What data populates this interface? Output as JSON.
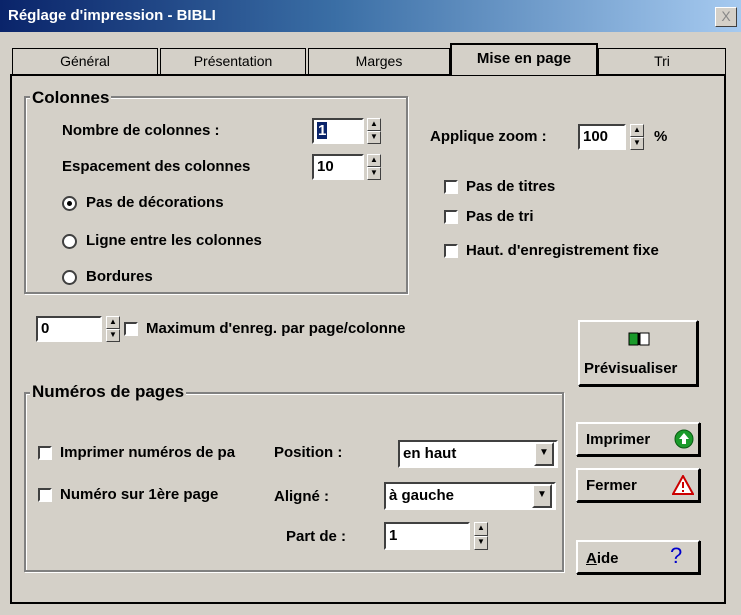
{
  "window": {
    "title": "Réglage d'impression - BIBLI",
    "close_glyph": "X"
  },
  "tabs": [
    "Général",
    "Présentation",
    "Marges",
    "Mise en page",
    "Tri"
  ],
  "colonnes": {
    "legend": "Colonnes",
    "nb_label": "Nombre de colonnes :",
    "nb_value": "1",
    "espacement_label": "Espacement des colonnes",
    "espacement_value": "10",
    "radios": [
      "Pas de décorations",
      "Ligne entre les colonnes",
      "Bordures"
    ],
    "selected_radio": 0
  },
  "zoom": {
    "label": "Applique zoom :",
    "value": "100",
    "unit": "%"
  },
  "options": [
    "Pas de titres",
    "Pas de tri",
    "Haut. d'enregistrement fixe"
  ],
  "max_enreg": {
    "value": "0",
    "label": "Maximum d'enreg. par page/colonne"
  },
  "numeros": {
    "legend": "Numéros de pages",
    "imprimer_label": "Imprimer numéros de pa",
    "premiere_label": "Numéro sur 1ère page",
    "position_label": "Position :",
    "position_value": "en haut",
    "aligne_label": "Aligné :",
    "aligne_value": "à gauche",
    "part_label": "Part de :",
    "part_value": "1"
  },
  "buttons": {
    "previsualiser": "Prévisualiser",
    "imprimer": "Imprimer",
    "fermer": "Fermer",
    "aide_accel": "A",
    "aide_rest": "ide",
    "aide_icon_glyph": "?"
  },
  "icons": {
    "previsualiser": "book-icon",
    "imprimer": "green-up-arrow-icon",
    "fermer": "warning-triangle-icon",
    "aide": "question-mark-icon"
  },
  "colors": {
    "titlebar": "#0a246a",
    "selection": "#0a246a",
    "print_icon": "#1a9a2a",
    "warning": "#cc0000",
    "help": "#0000cc"
  }
}
